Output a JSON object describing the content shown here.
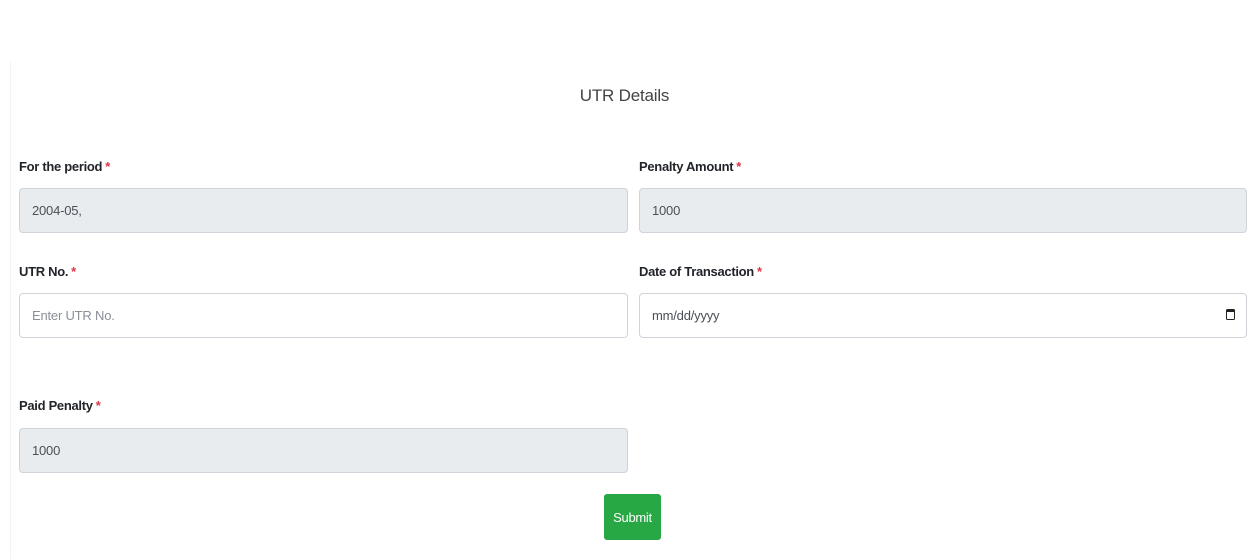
{
  "form": {
    "title": "UTR Details",
    "required_marker": "*",
    "period": {
      "label": "For the period",
      "value": "2004-05,"
    },
    "penalty_amount": {
      "label": "Penalty Amount",
      "value": "1000"
    },
    "utr_no": {
      "label": "UTR No.",
      "value": "",
      "placeholder": "Enter UTR No."
    },
    "date_of_transaction": {
      "label": "Date of Transaction",
      "placeholder": "mm/dd/yyyy",
      "icon": "calendar-icon"
    },
    "paid_penalty": {
      "label": "Paid Penalty",
      "value": "1000"
    },
    "submit_label": "Submit"
  },
  "colors": {
    "submit_button": "#28a745",
    "required_marker": "#dc3545",
    "readonly_field_bg": "#e9ecef"
  }
}
